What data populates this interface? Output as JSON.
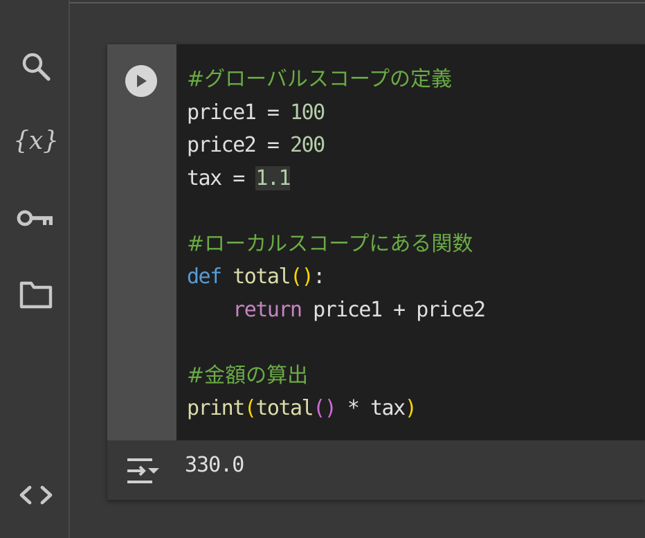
{
  "sidebar": {
    "icons": [
      {
        "name": "search-icon"
      },
      {
        "name": "variables-icon",
        "glyph": "{x}"
      },
      {
        "name": "key-icon"
      },
      {
        "name": "folder-icon"
      },
      {
        "name": "code-icon"
      }
    ]
  },
  "cell": {
    "code": {
      "l1_comment": "#グローバルスコープの定義",
      "l2_a": "price1 = ",
      "l2_num": "100",
      "l3_a": "price2 = ",
      "l3_num": "200",
      "l4_a": "tax = ",
      "l4_num": "1.1",
      "l6_comment": "#ローカルスコープにある関数",
      "l7_def": "def",
      "l7_sp": " ",
      "l7_fn": "total",
      "l7_open": "(",
      "l7_close": ")",
      "l7_colon": ":",
      "l8_indent": "    ",
      "l8_ret": "return",
      "l8_rest": " price1 + price2",
      "l10_comment": "#金額の算出",
      "l11_print": "print",
      "l11_open": "(",
      "l11_total": "total",
      "l11_p2open": "(",
      "l11_p2close": ")",
      "l11_rest": " * tax",
      "l11_close": ")"
    },
    "output": {
      "value": "330.0"
    }
  },
  "colors": {
    "comment": "#6aab45",
    "number": "#b5cea8",
    "keyword_def": "#569cd6",
    "keyword_return": "#c586c0",
    "function": "#dcdcaa"
  }
}
